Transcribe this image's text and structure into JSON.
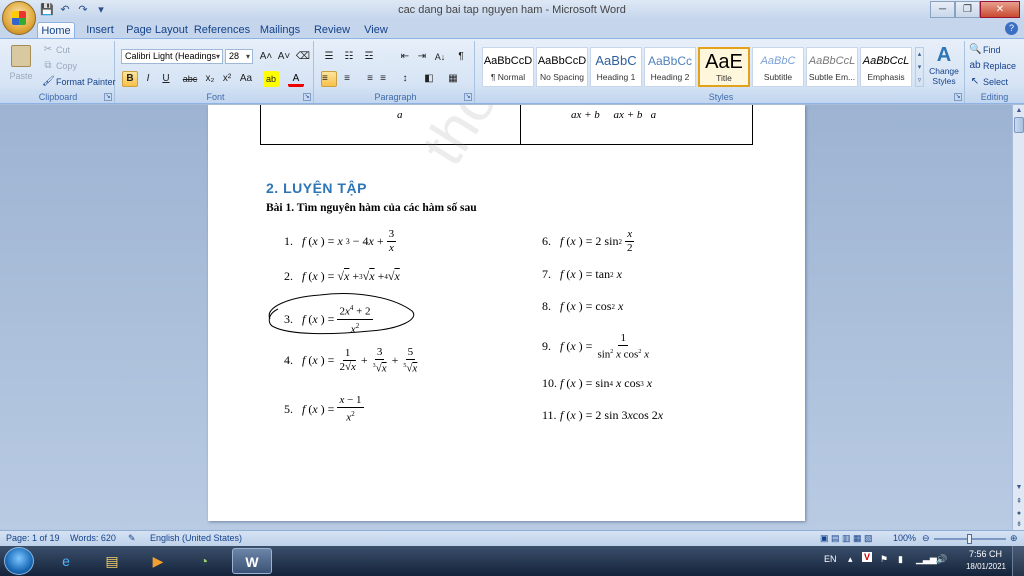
{
  "window": {
    "title": "cac dang bai tap nguyen ham - Microsoft Word",
    "controls": {
      "minimize": "─",
      "maximize": "❐",
      "close": "✕"
    }
  },
  "quick_access": {
    "save": "💾",
    "undo": "↶",
    "redo": "↷",
    "customize": "▾"
  },
  "tabs": [
    "Home",
    "Insert",
    "Page Layout",
    "References",
    "Mailings",
    "Review",
    "View"
  ],
  "active_tab": "Home",
  "ribbon": {
    "clipboard": {
      "label": "Clipboard",
      "paste": "Paste",
      "cut": "Cut",
      "copy": "Copy",
      "format_painter": "Format Painter"
    },
    "font": {
      "label": "Font",
      "family": "Calibri Light (Headings",
      "size": "28",
      "grow": "A˄",
      "shrink": "A˅",
      "clear": "⌫",
      "bold": "B",
      "italic": "I",
      "underline": "U",
      "strike": "abc",
      "subscript": "x₂",
      "superscript": "x²",
      "case": "Aa",
      "highlight": "ab",
      "color": "A"
    },
    "paragraph": {
      "label": "Paragraph",
      "bullets": "☰",
      "numbering": "☷",
      "multilevel": "☲",
      "dec_indent": "⇤",
      "inc_indent": "⇥",
      "sort": "A↓",
      "pilcrow": "¶",
      "align_left": "≡",
      "center": "≡",
      "align_right": "≡",
      "justify": "≡",
      "spacing": "↕",
      "shading": "◧",
      "borders": "▦"
    },
    "styles": {
      "label": "Styles",
      "items": [
        {
          "sample": "AaBbCcD",
          "name": "¶ Normal"
        },
        {
          "sample": "AaBbCcD",
          "name": "No Spacing"
        },
        {
          "sample": "AaBbC",
          "name": "Heading 1"
        },
        {
          "sample": "AaBbCc",
          "name": "Heading 2"
        },
        {
          "sample": "AaE",
          "name": "Title"
        },
        {
          "sample": "AaBbC",
          "name": "Subtitle"
        },
        {
          "sample": "AaBbCcL",
          "name": "Subtle Em..."
        },
        {
          "sample": "AaBbCcL",
          "name": "Emphasis"
        }
      ],
      "active_index": 4,
      "change_styles": "Change Styles"
    },
    "editing": {
      "label": "Editing",
      "find": "Find",
      "replace": "Replace",
      "select": "Select"
    }
  },
  "document": {
    "table_fragment_left": "a",
    "table_fragment_right": "ax + b     ax + b   a",
    "watermark": "thonlin",
    "heading": "2. LUYỆN TẬP",
    "exercise": "Bài 1. Tìm nguyên hàm của các hàm số sau",
    "left_items": [
      {
        "num": "1.",
        "expr": "f(x) = x³ − 4x + 3/x"
      },
      {
        "num": "2.",
        "expr": "f(x) = √x + ∛x + ∜x"
      },
      {
        "num": "3.",
        "expr": "f(x) = (2x⁴ + 2)/x²"
      },
      {
        "num": "4.",
        "expr": "f(x) = 1/(2√x) + 3/∛x + 5/⁵√x"
      },
      {
        "num": "5.",
        "expr": "f(x) = (x − 1)/x²"
      }
    ],
    "right_items": [
      {
        "num": "6.",
        "expr": "f(x) = 2sin² (x/2)"
      },
      {
        "num": "7.",
        "expr": "f(x) = tan² x"
      },
      {
        "num": "8.",
        "expr": "f(x) = cos² x"
      },
      {
        "num": "9.",
        "expr": "f(x) = 1/(sin² x cos² x)"
      },
      {
        "num": "10.",
        "expr": "f(x) = sin⁴ x cos³ x"
      },
      {
        "num": "11.",
        "expr": "f(x) = 2 sin 3x cos 2x"
      }
    ]
  },
  "statusbar": {
    "page": "Page: 1 of 19",
    "words": "Words: 620",
    "language": "English (United States)",
    "zoom": "100%"
  },
  "taskbar": {
    "lang": "EN",
    "time": "7:56 CH",
    "date": "18/01/2021"
  }
}
